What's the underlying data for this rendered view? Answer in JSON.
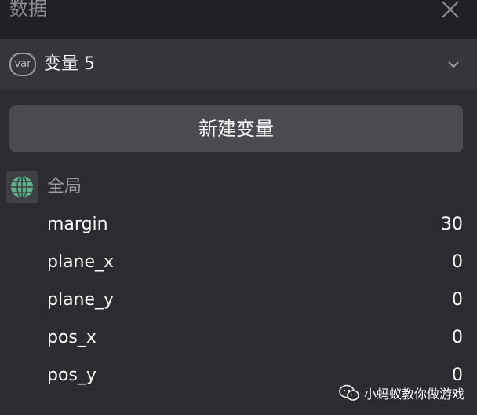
{
  "header": {
    "title": "数据"
  },
  "variable_selector": {
    "badge": "var",
    "selected": "变量 5"
  },
  "new_variable_button": {
    "label": "新建变量"
  },
  "group": {
    "label": "全局",
    "variables": [
      {
        "name": "margin",
        "value": "30"
      },
      {
        "name": "plane_x",
        "value": "0"
      },
      {
        "name": "plane_y",
        "value": "0"
      },
      {
        "name": "pos_x",
        "value": "0"
      },
      {
        "name": "pos_y",
        "value": "0"
      }
    ]
  },
  "watermark": {
    "text": "小蚂蚁教你做游戏"
  },
  "colors": {
    "panel_bg": "#2b2c30",
    "header_bg": "#202125",
    "selector_bg": "#35363b",
    "button_bg": "#4a4b50",
    "globe_green": "#5fb38a"
  },
  "icons": {
    "close": "close-icon",
    "chevron": "chevron-down-icon",
    "globe": "globe-icon",
    "wechat": "wechat-icon"
  }
}
